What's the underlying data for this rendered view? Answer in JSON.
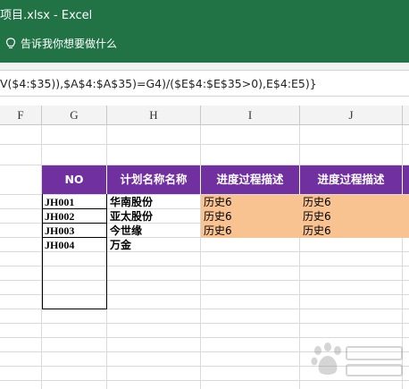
{
  "window": {
    "title": "项目.xlsx  -  Excel",
    "tell_me": "告诉我你想要做什么",
    "accent_color": "#217346"
  },
  "formula_bar": {
    "text": "V($4:$35)),$A$4:$A$35)=G4)/($E$4:$E$35>0),E$4:E5)}"
  },
  "columns": [
    "F",
    "G",
    "H",
    "I",
    "J"
  ],
  "table": {
    "header_color": "#7030a0",
    "highlight_color": "#f8c291",
    "headers": [
      "NO",
      "计划名称名称",
      "进度过程描述",
      "进度过程描述"
    ],
    "rows": [
      {
        "no": "JH001",
        "name": "华南股份",
        "i": "历史6",
        "j": "历史6"
      },
      {
        "no": "JH002",
        "name": "亚太股份",
        "i": "历史6",
        "j": "历史6"
      },
      {
        "no": "JH003",
        "name": "今世缘",
        "i": "历史6",
        "j": "历史6"
      },
      {
        "no": "JH004",
        "name": "万金",
        "i": "",
        "j": ""
      }
    ]
  },
  "watermark": {
    "icon": "baidu-paw-icon"
  }
}
